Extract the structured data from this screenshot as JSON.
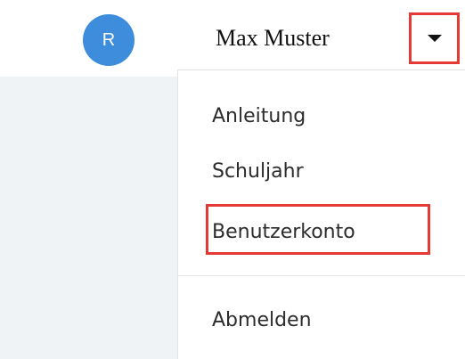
{
  "header": {
    "avatar_initial": "R",
    "user_name": "Max Muster"
  },
  "menu": {
    "items": [
      {
        "label": "Anleitung"
      },
      {
        "label": "Schuljahr"
      },
      {
        "label": "Benutzerkonto"
      },
      {
        "label": "Abmelden"
      }
    ]
  },
  "icons": {
    "dropdown_toggle": "caret-down-icon"
  },
  "colors": {
    "avatar_bg": "#3e8ddd",
    "highlight": "#e53935",
    "content_bg": "#f0f3f6"
  }
}
